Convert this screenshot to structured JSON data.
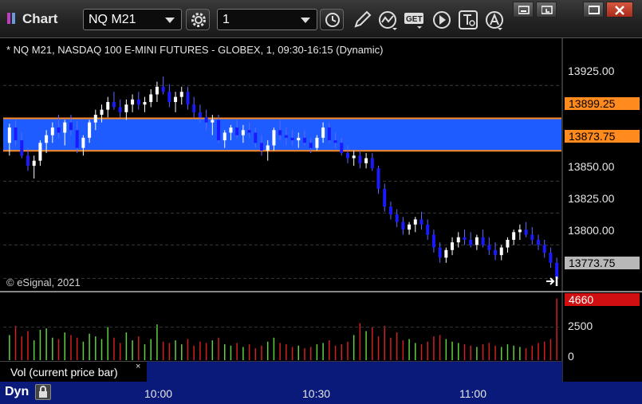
{
  "window": {
    "title": "Chart",
    "symbol": "NQ M21",
    "interval": "1",
    "get_label": "GET",
    "window_controls": [
      "minimize",
      "restore",
      "maximize",
      "close"
    ]
  },
  "toolbar": {
    "icons": [
      "gear-icon",
      "clock-icon",
      "pencil-icon",
      "study-icon",
      "get-data-icon",
      "play-icon",
      "text-tool-icon",
      "alert-icon"
    ]
  },
  "chart": {
    "header": "* NQ M21, NASDAQ 100 E-MINI FUTURES - GLOBEX, 1, 09:30-16:15 (Dynamic)",
    "copyright": "© eSignal, 2021",
    "price_labels": [
      "13925.00",
      "13850.00",
      "13825.00",
      "13800.00"
    ],
    "band_high_tag": "13899.25",
    "band_low_tag": "13873.75",
    "last_price_tag": "13773.75",
    "colors": {
      "band": "#1f5cff",
      "band_edge": "#ff8a1e",
      "up_bar": "#ffffff",
      "down_bar": "#1a1aff",
      "vol_up": "#60d040",
      "vol_down": "#d02020"
    }
  },
  "volume": {
    "label": "Vol (current price bar)",
    "close_symbol": "×",
    "current_tag": "4660",
    "scale_labels": [
      "2500",
      "0"
    ]
  },
  "time_axis": {
    "mode_label": "Dyn",
    "labels": [
      "10:00",
      "10:30",
      "11:00"
    ]
  },
  "chart_data": {
    "type": "candlestick",
    "instrument": "NQ M21",
    "band": {
      "high": 13899.25,
      "low": 13873.75
    },
    "last_price": 13773.75,
    "ylim": [
      13760,
      13950
    ],
    "yticks": [
      13800.0,
      13825.0,
      13850.0,
      13925.0
    ],
    "x_ticks": [
      "10:00",
      "10:30",
      "11:00"
    ],
    "bars": [
      [
        13880,
        13895,
        13870,
        13892
      ],
      [
        13892,
        13898,
        13878,
        13882
      ],
      [
        13882,
        13888,
        13868,
        13870
      ],
      [
        13870,
        13876,
        13858,
        13862
      ],
      [
        13862,
        13870,
        13852,
        13866
      ],
      [
        13866,
        13882,
        13862,
        13880
      ],
      [
        13880,
        13890,
        13872,
        13886
      ],
      [
        13886,
        13896,
        13880,
        13892
      ],
      [
        13892,
        13902,
        13884,
        13888
      ],
      [
        13888,
        13898,
        13878,
        13896
      ],
      [
        13896,
        13902,
        13886,
        13890
      ],
      [
        13890,
        13897,
        13872,
        13876
      ],
      [
        13876,
        13886,
        13870,
        13884
      ],
      [
        13884,
        13898,
        13880,
        13896
      ],
      [
        13896,
        13906,
        13890,
        13902
      ],
      [
        13902,
        13910,
        13896,
        13906
      ],
      [
        13906,
        13916,
        13900,
        13912
      ],
      [
        13912,
        13920,
        13906,
        13908
      ],
      [
        13908,
        13914,
        13900,
        13904
      ],
      [
        13904,
        13914,
        13898,
        13910
      ],
      [
        13910,
        13918,
        13904,
        13914
      ],
      [
        13914,
        13920,
        13906,
        13910
      ],
      [
        13910,
        13916,
        13904,
        13912
      ],
      [
        13912,
        13922,
        13908,
        13918
      ],
      [
        13918,
        13928,
        13912,
        13924
      ],
      [
        13924,
        13932,
        13918,
        13920
      ],
      [
        13920,
        13926,
        13908,
        13912
      ],
      [
        13912,
        13920,
        13904,
        13916
      ],
      [
        13916,
        13924,
        13910,
        13920
      ],
      [
        13920,
        13924,
        13906,
        13910
      ],
      [
        13910,
        13916,
        13900,
        13904
      ],
      [
        13904,
        13910,
        13896,
        13900
      ],
      [
        13900,
        13906,
        13890,
        13896
      ],
      [
        13896,
        13902,
        13886,
        13898
      ],
      [
        13898,
        13902,
        13880,
        13882
      ],
      [
        13882,
        13890,
        13876,
        13888
      ],
      [
        13888,
        13894,
        13882,
        13892
      ],
      [
        13892,
        13898,
        13884,
        13886
      ],
      [
        13886,
        13894,
        13880,
        13890
      ],
      [
        13890,
        13896,
        13884,
        13888
      ],
      [
        13888,
        13892,
        13876,
        13880
      ],
      [
        13880,
        13886,
        13870,
        13874
      ],
      [
        13874,
        13882,
        13866,
        13878
      ],
      [
        13878,
        13892,
        13874,
        13890
      ],
      [
        13890,
        13898,
        13882,
        13886
      ],
      [
        13886,
        13892,
        13878,
        13884
      ],
      [
        13884,
        13890,
        13878,
        13882
      ],
      [
        13882,
        13888,
        13876,
        13884
      ],
      [
        13884,
        13890,
        13878,
        13880
      ],
      [
        13880,
        13884,
        13872,
        13876
      ],
      [
        13876,
        13886,
        13874,
        13884
      ],
      [
        13884,
        13896,
        13880,
        13892
      ],
      [
        13892,
        13896,
        13880,
        13882
      ],
      [
        13882,
        13888,
        13876,
        13880
      ],
      [
        13880,
        13884,
        13870,
        13872
      ],
      [
        13872,
        13878,
        13864,
        13868
      ],
      [
        13868,
        13874,
        13862,
        13870
      ],
      [
        13870,
        13874,
        13860,
        13864
      ],
      [
        13864,
        13872,
        13860,
        13868
      ],
      [
        13868,
        13872,
        13858,
        13860
      ],
      [
        13860,
        13862,
        13840,
        13844
      ],
      [
        13844,
        13848,
        13826,
        13830
      ],
      [
        13830,
        13834,
        13820,
        13824
      ],
      [
        13824,
        13828,
        13814,
        13818
      ],
      [
        13818,
        13822,
        13808,
        13812
      ],
      [
        13812,
        13818,
        13808,
        13816
      ],
      [
        13816,
        13822,
        13810,
        13820
      ],
      [
        13820,
        13826,
        13812,
        13816
      ],
      [
        13816,
        13820,
        13804,
        13808
      ],
      [
        13808,
        13812,
        13794,
        13798
      ],
      [
        13798,
        13802,
        13786,
        13790
      ],
      [
        13790,
        13798,
        13786,
        13796
      ],
      [
        13796,
        13806,
        13792,
        13802
      ],
      [
        13802,
        13810,
        13798,
        13806
      ],
      [
        13806,
        13812,
        13800,
        13804
      ],
      [
        13804,
        13810,
        13798,
        13800
      ],
      [
        13800,
        13808,
        13796,
        13806
      ],
      [
        13806,
        13812,
        13798,
        13800
      ],
      [
        13800,
        13806,
        13792,
        13796
      ],
      [
        13796,
        13802,
        13788,
        13792
      ],
      [
        13792,
        13800,
        13788,
        13798
      ],
      [
        13798,
        13806,
        13794,
        13804
      ],
      [
        13804,
        13812,
        13800,
        13810
      ],
      [
        13810,
        13816,
        13804,
        13812
      ],
      [
        13812,
        13818,
        13806,
        13808
      ],
      [
        13808,
        13814,
        13800,
        13804
      ],
      [
        13804,
        13808,
        13796,
        13800
      ],
      [
        13800,
        13804,
        13790,
        13794
      ],
      [
        13794,
        13798,
        13782,
        13786
      ],
      [
        13786,
        13790,
        13770,
        13774
      ]
    ],
    "volume": [
      1900,
      2600,
      1800,
      2200,
      1500,
      2300,
      2400,
      1700,
      1600,
      2100,
      1900,
      1700,
      1400,
      2000,
      1800,
      1600,
      2500,
      1700,
      1300,
      2100,
      1500,
      1800,
      1200,
      1600,
      2700,
      1400,
      1300,
      1500,
      1200,
      1600,
      1100,
      1400,
      1300,
      1500,
      1700,
      1200,
      1100,
      1300,
      1000,
      1200,
      900,
      1100,
      1400,
      1700,
      1300,
      1200,
      1000,
      1100,
      900,
      1000,
      1200,
      1300,
      1500,
      1100,
      1200,
      1400,
      1900,
      2800,
      2200,
      2500,
      1800,
      2600,
      1700,
      2100,
      1500,
      1600,
      1300,
      1200,
      1400,
      1800,
      1900,
      1600,
      1400,
      1300,
      1200,
      1100,
      1000,
      1200,
      1300,
      1100,
      1000,
      1200,
      1100,
      1000,
      900,
      1100,
      1300,
      1400,
      1600,
      4660
    ]
  }
}
